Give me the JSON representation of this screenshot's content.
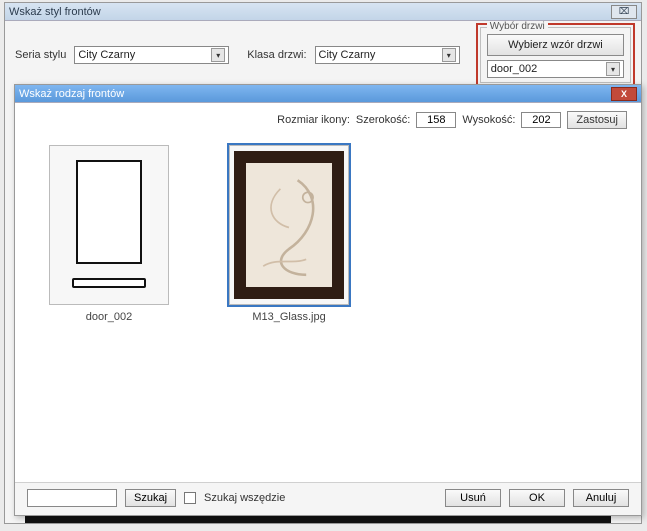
{
  "parent": {
    "title": "Wskaż styl frontów",
    "series_label": "Seria stylu",
    "series_value": "City Czarny",
    "class_label": "Klasa drzwi:",
    "class_value": "City Czarny",
    "door_group_legend": "Wybór drzwi",
    "choose_button": "Wybierz wzór drzwi",
    "door_combo_value": "door_002",
    "close_glyph": "⌧"
  },
  "child": {
    "title": "Wskaż rodzaj frontów",
    "close_glyph": "X",
    "icon_size_label": "Rozmiar ikony:",
    "width_label": "Szerokość:",
    "width_value": "158",
    "height_label": "Wysokość:",
    "height_value": "202",
    "apply_label": "Zastosuj",
    "items": [
      {
        "label": "door_002"
      },
      {
        "label": "M13_Glass.jpg"
      }
    ],
    "search_btn": "Szukaj",
    "search_all_label": "Szukaj wszędzie",
    "delete_btn": "Usuń",
    "ok_btn": "OK",
    "cancel_btn": "Anuluj"
  }
}
